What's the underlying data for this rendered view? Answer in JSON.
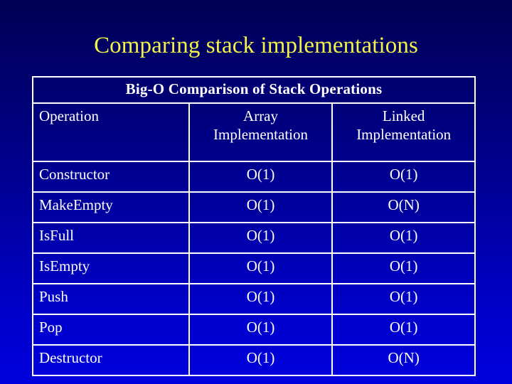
{
  "slide": {
    "title": "Comparing stack implementations",
    "title_color": "#F2F24A",
    "background_top_color": "#000055",
    "background_bottom_color": "#0000DD",
    "border_color": "#FFFFFF",
    "text_color": "#FFFFFF"
  },
  "table": {
    "caption": "Big-O Comparison of Stack Operations",
    "columns": [
      {
        "label": "Operation",
        "align": "left"
      },
      {
        "label": "Array Implementation",
        "line1": "Array",
        "line2": "Implementation",
        "align": "center"
      },
      {
        "label": "Linked Implementation",
        "line1": "Linked",
        "line2": "Implementation",
        "align": "center"
      }
    ],
    "rows": [
      {
        "operation": "Constructor",
        "array": "O(1)",
        "linked": "O(1)"
      },
      {
        "operation": "MakeEmpty",
        "array": "O(1)",
        "linked": "O(N)"
      },
      {
        "operation": "IsFull",
        "array": "O(1)",
        "linked": "O(1)"
      },
      {
        "operation": "IsEmpty",
        "array": "O(1)",
        "linked": "O(1)"
      },
      {
        "operation": "Push",
        "array": "O(1)",
        "linked": "O(1)"
      },
      {
        "operation": "Pop",
        "array": "O(1)",
        "linked": "O(1)"
      },
      {
        "operation": "Destructor",
        "array": "O(1)",
        "linked": "O(N)"
      }
    ]
  }
}
